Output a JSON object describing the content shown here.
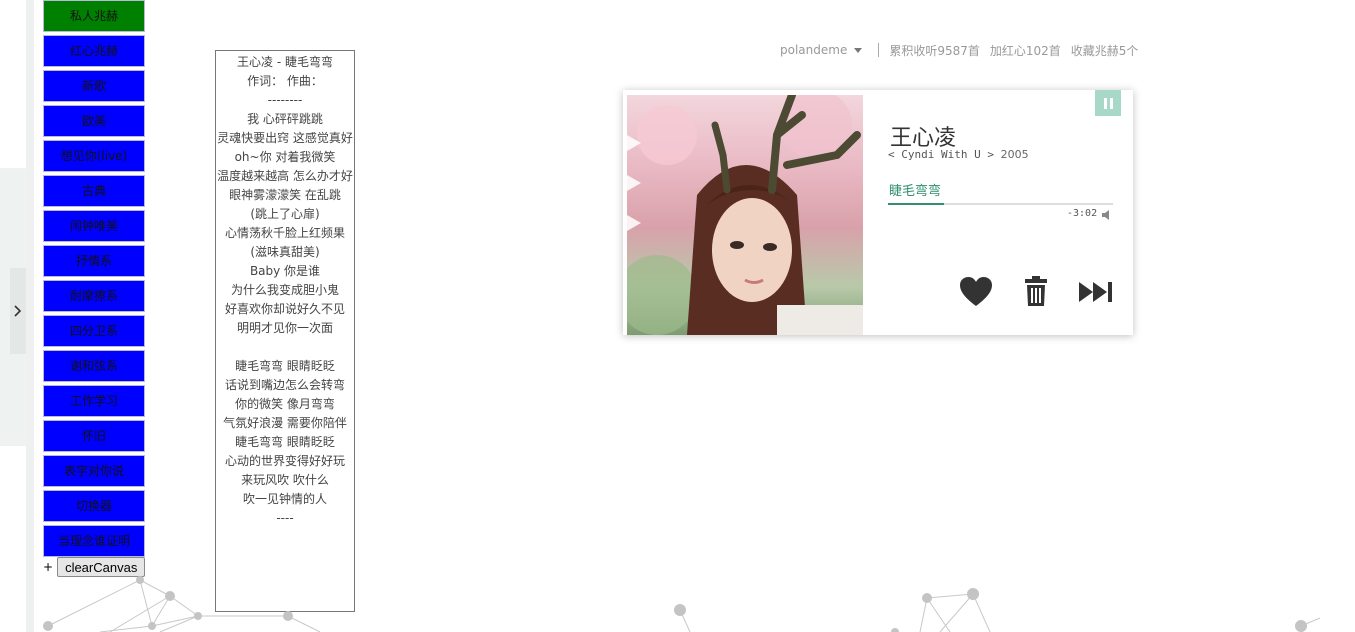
{
  "playlists": [
    {
      "label": "私人兆赫",
      "active": true
    },
    {
      "label": "红心兆赫",
      "active": false
    },
    {
      "label": "新歌",
      "active": false
    },
    {
      "label": "欧美",
      "active": false
    },
    {
      "label": "想见你(live)",
      "active": false
    },
    {
      "label": "古典",
      "active": false
    },
    {
      "label": "闹钟唯美",
      "active": false
    },
    {
      "label": "抒情系",
      "active": false
    },
    {
      "label": "耐摩擦系",
      "active": false
    },
    {
      "label": "四分卫系",
      "active": false
    },
    {
      "label": "谢和弦系",
      "active": false
    },
    {
      "label": "工作学习",
      "active": false
    },
    {
      "label": "怀旧",
      "active": false
    },
    {
      "label": "表字对你说",
      "active": false
    },
    {
      "label": "切换器",
      "active": false
    },
    {
      "label": "当理念谁证明",
      "active": false
    }
  ],
  "clear": {
    "plus": "+",
    "button_label": "clearCanvas"
  },
  "lyrics": [
    "王心凌 - 睫毛弯弯",
    "作词：  作曲：",
    "--------",
    "我 心砰砰跳跳",
    "灵魂快要出窍 这感觉真好",
    "oh~你 对着我微笑",
    "温度越来越高 怎么办才好",
    "眼神雾濛濛笑 在乱跳",
    "(跳上了心扉)",
    "心情荡秋千脸上红频果",
    "(滋味真甜美)",
    "Baby 你是谁",
    "为什么我变成胆小鬼",
    "好喜欢你却说好久不见",
    "明明才见你一次面",
    "",
    "睫毛弯弯 眼睛眨眨",
    "话说到嘴边怎么会转弯",
    "你的微笑 像月弯弯",
    "气氛好浪漫 需要你陪伴",
    "睫毛弯弯 眼睛眨眨",
    "心动的世界变得好好玩",
    "来玩风吹 吹什么",
    "吹一见钟情的人",
    "----"
  ],
  "user": {
    "username": "polandeme",
    "listened": "累积收听9587首",
    "loved": "加红心102首",
    "collected": "收藏兆赫5个"
  },
  "player": {
    "artist": "王心凌",
    "album": "< Cyndi With U >",
    "year": "2005",
    "song": "睫毛弯弯",
    "time_remaining": "-3:02",
    "progress_fraction": 0.25,
    "accent_color": "#2f8f6f",
    "pause_color": "#a8d8c8"
  }
}
